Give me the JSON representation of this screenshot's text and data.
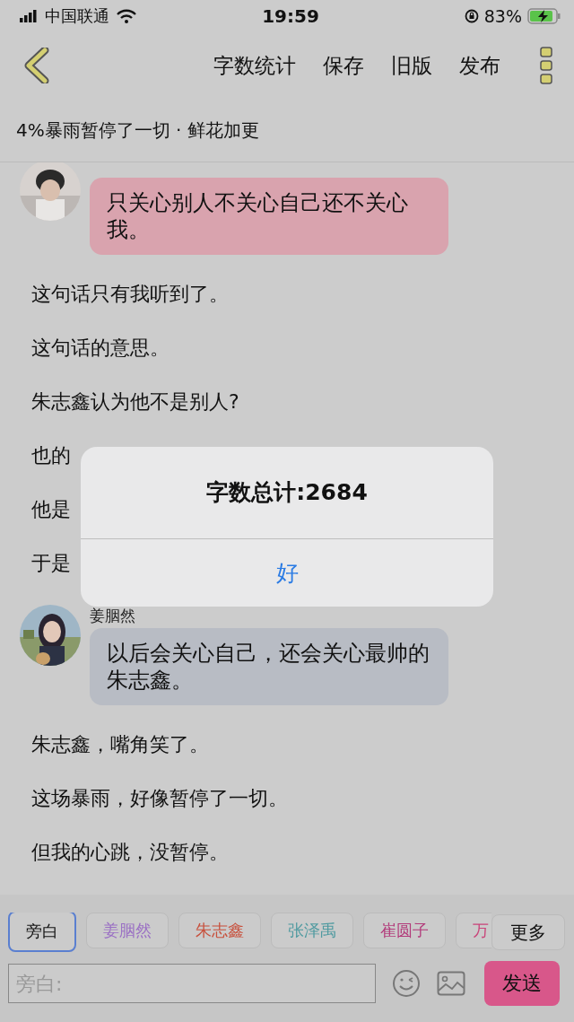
{
  "status_bar": {
    "carrier": "中国联通",
    "time": "19:59",
    "battery": "83%"
  },
  "nav": {
    "actions": [
      "字数统计",
      "保存",
      "旧版",
      "发布"
    ]
  },
  "chapter_title": "4%暴雨暂停了一切 · 鲜花加更",
  "chat": [
    {
      "kind": "message",
      "text": "只关心别人不关心自己还不关心我。",
      "color": "#d9a3ae"
    },
    {
      "kind": "paragraph",
      "text": "这句话只有我听到了。"
    },
    {
      "kind": "paragraph",
      "text": "这句话的意思。"
    },
    {
      "kind": "paragraph",
      "text": "朱志鑫认为他不是别人?"
    },
    {
      "kind": "paragraph",
      "text": "也的"
    },
    {
      "kind": "paragraph",
      "text": "他是"
    },
    {
      "kind": "paragraph",
      "text": "于是"
    },
    {
      "kind": "message",
      "name": "姜胭然",
      "text": "以后会关心自己，还会关心最帅的朱志鑫。",
      "color": "#b8bcc4"
    },
    {
      "kind": "paragraph",
      "text": "朱志鑫，嘴角笑了。"
    },
    {
      "kind": "paragraph",
      "text": "这场暴雨，好像暂停了一切。"
    },
    {
      "kind": "paragraph",
      "text": "但我的心跳，没暂停。"
    }
  ],
  "roles": [
    {
      "label": "旁白",
      "selected": true,
      "color": "#111111"
    },
    {
      "label": "姜胭然",
      "selected": false,
      "color": "#9a6fc4"
    },
    {
      "label": "朱志鑫",
      "selected": false,
      "color": "#c8503c"
    },
    {
      "label": "张泽禹",
      "selected": false,
      "color": "#4f9aa0"
    },
    {
      "label": "崔圆子",
      "selected": false,
      "color": "#b23a7a"
    },
    {
      "label": "万",
      "selected": false,
      "color": "#c9457a"
    }
  ],
  "more_button": "更多",
  "input": {
    "placeholder": "旁白:"
  },
  "send_button": "发送",
  "alert": {
    "title": "字数总计:2684",
    "button": "好"
  }
}
